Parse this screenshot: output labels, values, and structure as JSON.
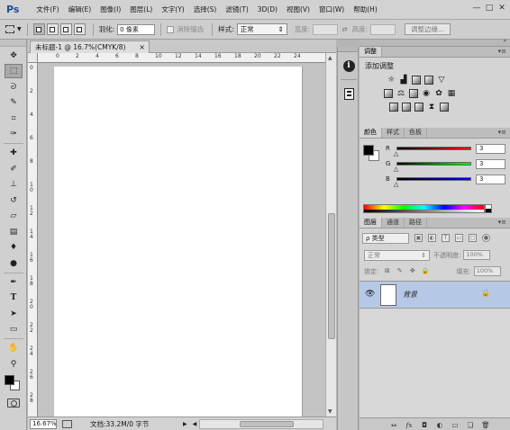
{
  "app": {
    "logo": "Ps"
  },
  "menu": [
    "文件(F)",
    "编辑(E)",
    "图像(I)",
    "图层(L)",
    "文字(Y)",
    "选择(S)",
    "滤镜(T)",
    "3D(D)",
    "视图(V)",
    "窗口(W)",
    "帮助(H)"
  ],
  "window_controls": [
    "—",
    "□",
    "✕"
  ],
  "options": {
    "feather_label": "羽化:",
    "feather_value": "0 像素",
    "antialias_label": "消除锯齿",
    "style_label": "样式:",
    "style_value": "正常",
    "width_label": "宽度:",
    "height_label": "高度:",
    "refine_button": "调整边缘..."
  },
  "document": {
    "tab_title": "未标题-1 @ 16.7%(CMYK/8)",
    "close": "×",
    "zoom": "16.67%",
    "doc_info": "文档:33.2M/0 字节",
    "ruler_h": [
      "0",
      "2",
      "4",
      "6",
      "8",
      "10",
      "12",
      "14",
      "16",
      "18",
      "20",
      "22",
      "24"
    ],
    "ruler_v": [
      "0",
      "2",
      "4",
      "6",
      "8",
      "1 0",
      "1 2",
      "1 4",
      "1 6",
      "1 8",
      "2 0",
      "2 2",
      "2 4",
      "2 6",
      "2 8"
    ]
  },
  "panels": {
    "adjustments": {
      "tab": "调整",
      "title": "添加调整"
    },
    "color": {
      "tabs": [
        "颜色",
        "样式",
        "色板"
      ],
      "r_label": "R",
      "g_label": "G",
      "b_label": "B",
      "r_value": "3",
      "g_value": "3",
      "b_value": "3",
      "colors": {
        "r_bar": "#ff0000",
        "g_bar": "#00ff00",
        "b_bar": "#0000ff"
      }
    },
    "layers": {
      "tabs": [
        "图层",
        "通道",
        "路径"
      ],
      "filter": "ρ 类型",
      "blend_mode": "正常",
      "opacity_label": "不透明度:",
      "opacity_value": "100%",
      "lock_label": "锁定:",
      "fill_label": "填充:",
      "fill_value": "100%",
      "layer_name": "背景",
      "footer_icons": [
        "link-icon",
        "fx-icon",
        "mask-icon",
        "adjustment-icon",
        "folder-icon",
        "new-layer-icon",
        "trash-icon"
      ]
    }
  },
  "footer_glyphs": {
    "link": "⇔",
    "fx": "fx",
    "mask": "◘",
    "adjust": "◐",
    "folder": "▭",
    "new": "❏",
    "trash": "🗑"
  }
}
